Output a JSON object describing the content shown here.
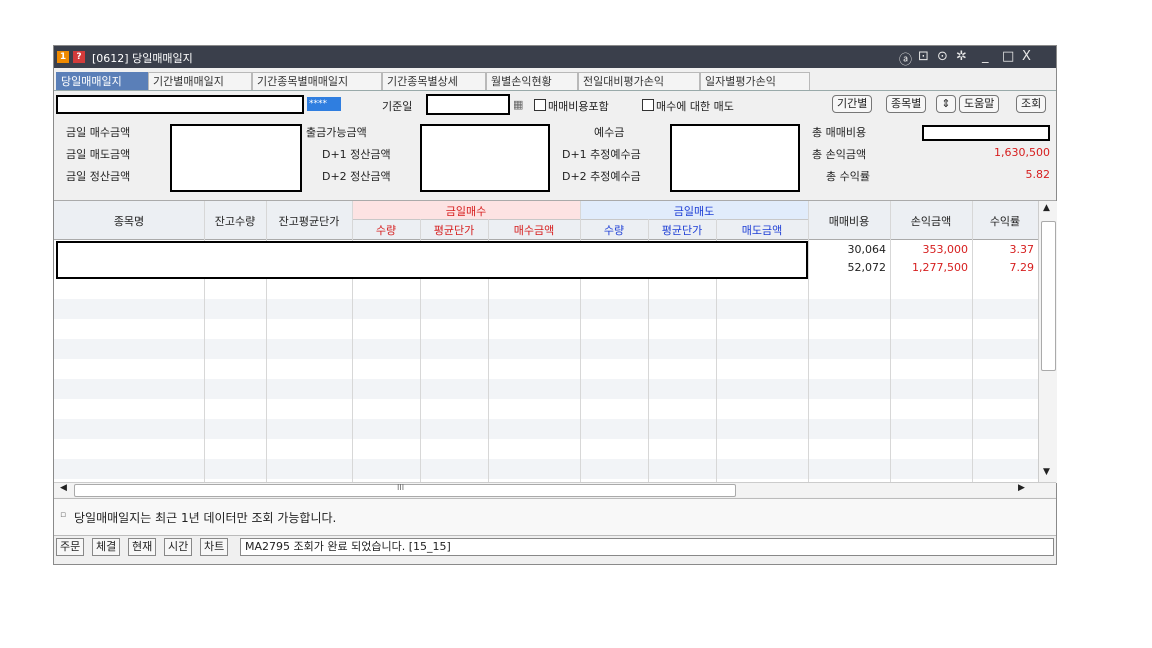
{
  "window": {
    "badge_1": "1",
    "badge_2": "?",
    "title": "[0612] 당일매매일지",
    "controls": [
      "ⓐ",
      "⊡",
      "⊙",
      "✲",
      "_",
      "□",
      "X"
    ]
  },
  "tabs": [
    "당일매매일지",
    "기간별매매일지",
    "기간종목별매매일지",
    "기간종목별상세",
    "월별손익현황",
    "전일대비평가손익",
    "일자별평가손익"
  ],
  "query": {
    "password_mask": "****",
    "date_label": "기준일",
    "include_fee_label": "매매비용포함",
    "sell_for_buy_label": "매수에 대한 매도",
    "buttons": {
      "period": "기간별",
      "by_item": "종목별",
      "help": "도움말",
      "search": "조회"
    }
  },
  "summary": {
    "labels": {
      "today_buy": "금일 매수금액",
      "today_sell": "금일 매도금액",
      "today_settle": "금일 정산금액",
      "withdrawable": "출금가능금액",
      "d1_settle": "D+1 정산금액",
      "d2_settle": "D+2 정산금액",
      "deposit": "예수금",
      "d1_deposit": "D+1 추정예수금",
      "d2_deposit": "D+2 추정예수금",
      "total_fee": "총 매매비용",
      "total_pnl": "총 손익금액",
      "total_return": "총 수익률"
    },
    "total_pnl_value": "1,630,500",
    "total_return_value": "5.82"
  },
  "grid": {
    "headers": {
      "item_name": "종목명",
      "balance_qty": "잔고수량",
      "balance_avg": "잔고평균단가",
      "today_buy": "금일매수",
      "buy_qty": "수량",
      "buy_avg": "평균단가",
      "buy_amount": "매수금액",
      "today_sell": "금일매도",
      "sell_qty": "수량",
      "sell_avg": "평균단가",
      "sell_amount": "매도금액",
      "fee": "매매비용",
      "pnl": "손익금액",
      "return": "수익률"
    },
    "rows": [
      {
        "fee": "30,064",
        "pnl": "353,000",
        "return": "3.37"
      },
      {
        "fee": "52,072",
        "pnl": "1,277,500",
        "return": "7.29"
      }
    ],
    "hscroll_mark": "III"
  },
  "info_text": "당일매매일지는 최근 1년 데이터만 조회 가능합니다.",
  "status": {
    "buttons": [
      "주문",
      "체결",
      "현재",
      "시간",
      "차트"
    ],
    "message": "MA2795 조회가 완료 되었습니다. [15_15]"
  },
  "colors": {
    "buy": "#d61e1e",
    "sell": "#1e3fd6",
    "active_tab": "#5a7fb8",
    "titlebar": "#3a3f4b"
  }
}
